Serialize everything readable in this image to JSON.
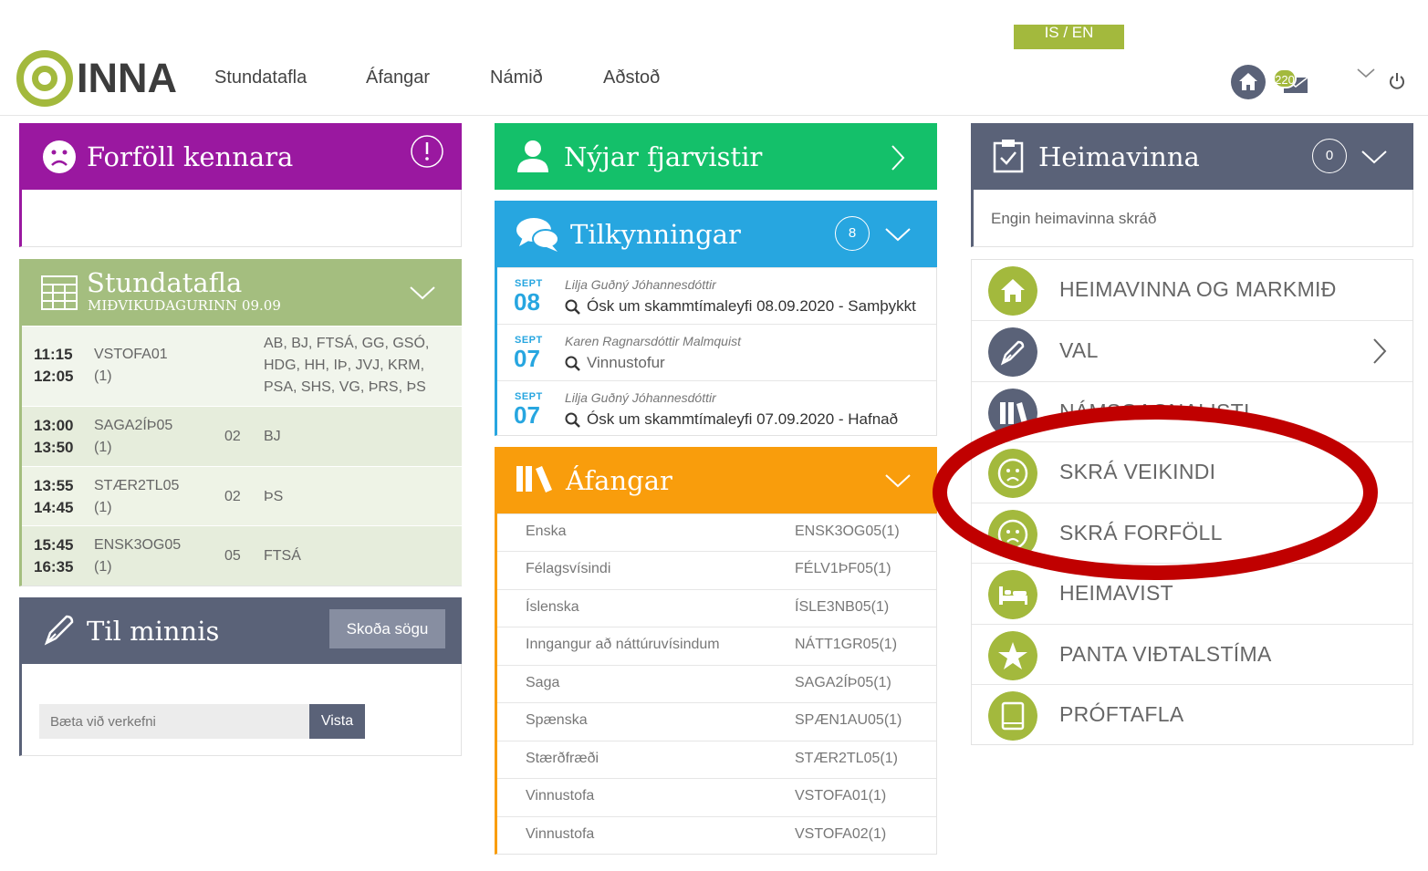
{
  "header": {
    "lang": "IS / EN",
    "logo_text": "INNA",
    "nav": [
      "Stundatafla",
      "Áfangar",
      "Námið",
      "Aðstoð"
    ],
    "mail_count": "220",
    "colors": {
      "green": "#a3b93d",
      "slate": "#5a6278"
    }
  },
  "forfoll": {
    "title": "Forföll kennara",
    "color": "#9a18a0"
  },
  "stundatafla": {
    "title": "Stundatafla",
    "subtitle": "MIÐVIKUDAGURINN 09.09",
    "rows": [
      {
        "start": "11:15",
        "end": "12:05",
        "code": "VSTOFA01",
        "group": "(1)",
        "room": "",
        "teachers": "AB, BJ, FTSÁ, GG, GSÓ, HDG, HH, IÞ, JVJ, KRM, PSA, SHS, VG, ÞRS, ÞS"
      },
      {
        "start": "13:00",
        "end": "13:50",
        "code": "SAGA2ÍÞ05",
        "group": "(1)",
        "room": "02",
        "teachers": "BJ"
      },
      {
        "start": "13:55",
        "end": "14:45",
        "code": "STÆR2TL05",
        "group": "(1)",
        "room": "02",
        "teachers": "ÞS"
      },
      {
        "start": "15:45",
        "end": "16:35",
        "code": "ENSK3OG05",
        "group": "(1)",
        "room": "05",
        "teachers": "FTSÁ"
      }
    ]
  },
  "minnis": {
    "title": "Til minnis",
    "history_button": "Skoða sögu",
    "input_placeholder": "Bæta við verkefni",
    "save_button": "Vista"
  },
  "fjarvistir": {
    "title": "Nýjar fjarvistir",
    "color": "#14c06a"
  },
  "tilkynningar": {
    "title": "Tilkynningar",
    "count": "8",
    "items": [
      {
        "month": "SEPT",
        "day": "08",
        "author": "Lilja Guðný Jóhannesdóttir",
        "subject": "Ósk um skammtímaleyfi 08.09.2020 - Samþykkt"
      },
      {
        "month": "SEPT",
        "day": "07",
        "author": "Karen Ragnarsdóttir Malmquist",
        "subject": "Vinnustofur"
      },
      {
        "month": "SEPT",
        "day": "07",
        "author": "Lilja Guðný Jóhannesdóttir",
        "subject": "Ósk um skammtímaleyfi 07.09.2020 - Hafnað"
      }
    ]
  },
  "afangar": {
    "title": "Áfangar",
    "items": [
      {
        "name": "Enska",
        "code": "ENSK3OG05(1)"
      },
      {
        "name": "Félagsvísindi",
        "code": "FÉLV1ÞF05(1)"
      },
      {
        "name": "Íslenska",
        "code": "ÍSLE3NB05(1)"
      },
      {
        "name": "Inngangur að náttúruvísindum",
        "code": "NÁTT1GR05(1)"
      },
      {
        "name": "Saga",
        "code": "SAGA2ÍÞ05(1)"
      },
      {
        "name": "Spænska",
        "code": "SPÆN1AU05(1)"
      },
      {
        "name": "Stærðfræði",
        "code": "STÆR2TL05(1)"
      },
      {
        "name": "Vinnustofa",
        "code": "VSTOFA01(1)"
      },
      {
        "name": "Vinnustofa",
        "code": "VSTOFA02(1)"
      }
    ]
  },
  "heimavinna": {
    "title": "Heimavinna",
    "count": "0",
    "empty_text": "Engin heimavinna skráð"
  },
  "menu": [
    {
      "label": "HEIMAVINNA OG MARKMIÐ",
      "icon": "home-icon"
    },
    {
      "label": "VAL",
      "icon": "pen-icon"
    },
    {
      "label": "NÁMSGAGNALISTI",
      "icon": "books-icon"
    },
    {
      "label": "SKRÁ VEIKINDI",
      "icon": "sad-face-icon"
    },
    {
      "label": "SKRÁ FORFÖLL",
      "icon": "sad-face-icon"
    },
    {
      "label": "HEIMAVIST",
      "icon": "bed-icon"
    },
    {
      "label": "PANTA VIÐTALSTÍMA",
      "icon": "star-icon"
    },
    {
      "label": "PRÓFTAFLA",
      "icon": "book-icon"
    }
  ]
}
